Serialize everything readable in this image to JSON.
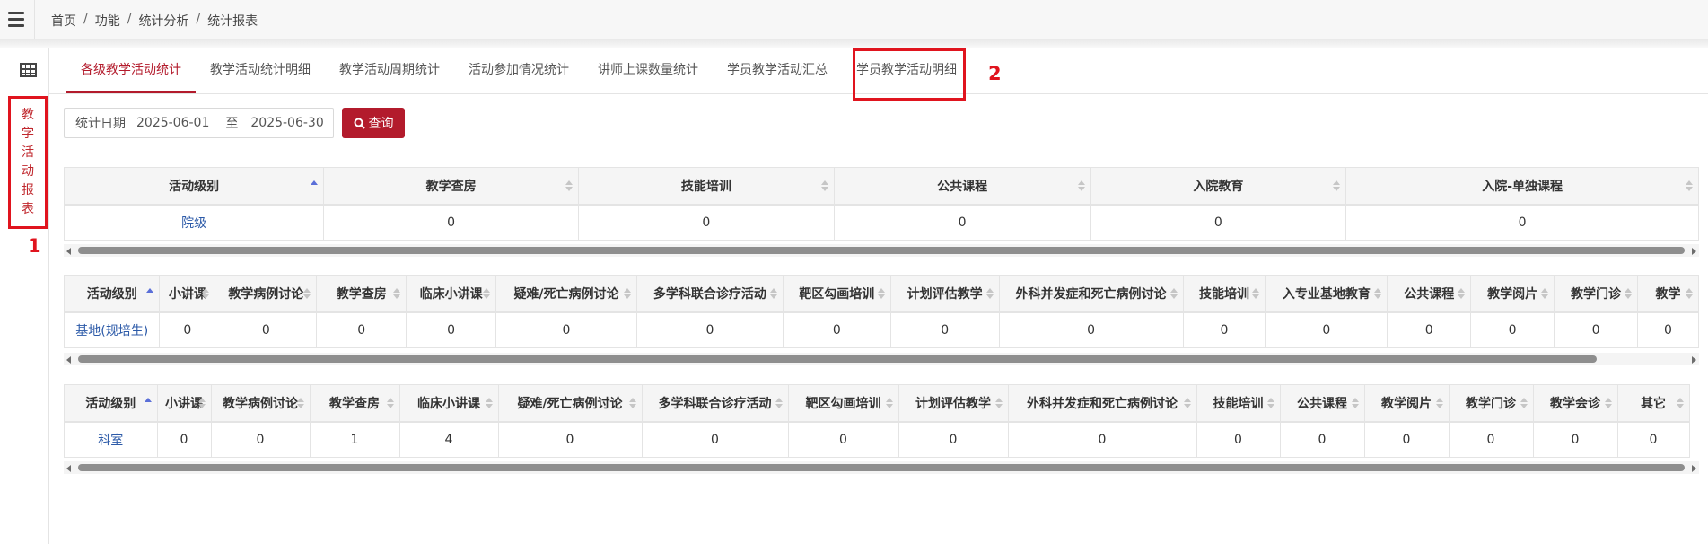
{
  "breadcrumb": [
    "首页",
    "功能",
    "统计分析",
    "统计报表"
  ],
  "side_nav": {
    "label_chars": [
      "教",
      "学",
      "活",
      "动",
      "报",
      "表"
    ]
  },
  "annotations": {
    "marker1": "1",
    "marker2": "2"
  },
  "tabs": [
    {
      "label": "各级教学活动统计",
      "active": true
    },
    {
      "label": "教学活动统计明细",
      "active": false
    },
    {
      "label": "教学活动周期统计",
      "active": false
    },
    {
      "label": "活动参加情况统计",
      "active": false
    },
    {
      "label": "讲师上课数量统计",
      "active": false
    },
    {
      "label": "学员教学活动汇总",
      "active": false
    },
    {
      "label": "学员教学活动明细",
      "active": false
    }
  ],
  "filter": {
    "date_label": "统计日期",
    "start_date": "2025-06-01",
    "to_label": "至",
    "end_date": "2025-06-30",
    "query_label": "查询"
  },
  "tables": [
    {
      "columns": [
        "活动级别",
        "教学查房",
        "技能培训",
        "公共课程",
        "入院教育",
        "入院-单独课程"
      ],
      "rows": [
        [
          "院级",
          "0",
          "0",
          "0",
          "0",
          "0"
        ]
      ]
    },
    {
      "columns": [
        "活动级别",
        "小讲课",
        "教学病例讨论",
        "教学查房",
        "临床小讲课",
        "疑难/死亡病例讨论",
        "多学科联合诊疗活动",
        "靶区勾画培训",
        "计划评估教学",
        "外科并发症和死亡病例讨论",
        "技能培训",
        "入专业基地教育",
        "公共课程",
        "教学阅片",
        "教学门诊",
        "教学"
      ],
      "rows": [
        [
          "基地(规培生)",
          "0",
          "0",
          "0",
          "0",
          "0",
          "0",
          "0",
          "0",
          "0",
          "0",
          "0",
          "0",
          "0",
          "0",
          "0"
        ]
      ]
    },
    {
      "columns": [
        "活动级别",
        "小讲课",
        "教学病例讨论",
        "教学查房",
        "临床小讲课",
        "疑难/死亡病例讨论",
        "多学科联合诊疗活动",
        "靶区勾画培训",
        "计划评估教学",
        "外科并发症和死亡病例讨论",
        "技能培训",
        "公共课程",
        "教学阅片",
        "教学门诊",
        "教学会诊",
        "其它"
      ],
      "rows": [
        [
          "科室",
          "0",
          "0",
          "1",
          "4",
          "0",
          "0",
          "0",
          "0",
          "0",
          "0",
          "0",
          "0",
          "0",
          "0",
          "0"
        ]
      ]
    }
  ]
}
